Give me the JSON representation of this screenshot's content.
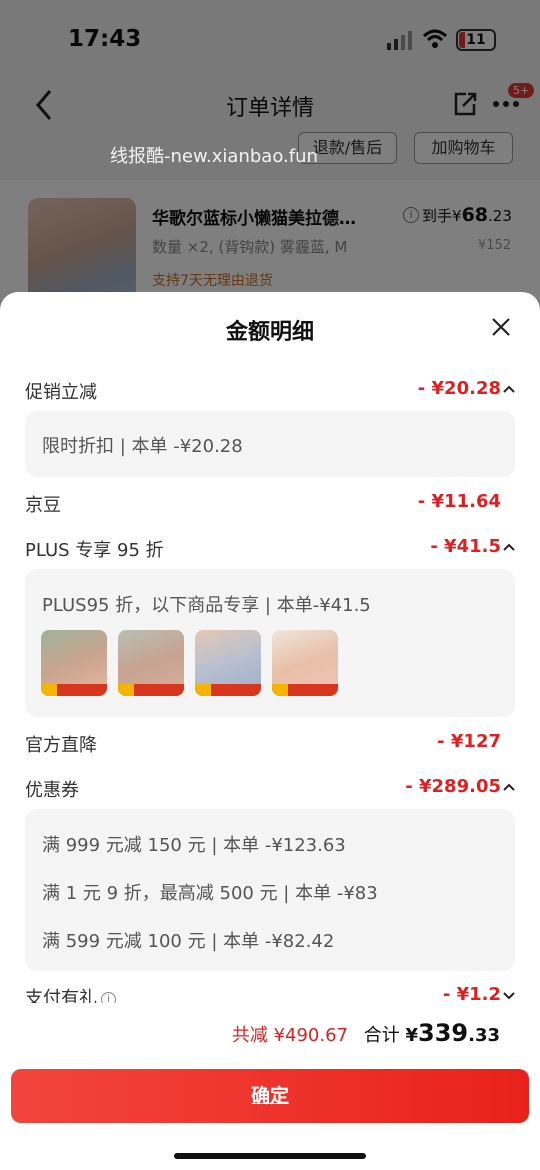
{
  "status_bar": {
    "time": "17:43",
    "battery": "11",
    "icons": [
      "signal-icon",
      "wifi-icon",
      "battery-icon"
    ]
  },
  "background_page": {
    "title": "订单详情",
    "more_badge": "5+",
    "watermark": "线报酷-new.xianbao.fun",
    "refund_button": "退款/售后",
    "add_cart_button": "加购物车",
    "product": {
      "title": "华歌尔蓝标小懒猫美拉德…",
      "spec": "数量 ×2, (背钩款) 雾霾蓝, M",
      "return_policy": "支持7天无理由退货",
      "price_prefix": "到手",
      "price_symbol": "¥",
      "price_int": "68",
      "price_dec": ".23",
      "original_price": "¥152"
    }
  },
  "sheet": {
    "title": "金额明细",
    "lines": {
      "promo": {
        "label": "促销立减",
        "amount": "- ¥20.28",
        "expanded": true
      },
      "jingdou": {
        "label": "京豆",
        "amount": "- ¥11.64"
      },
      "plus": {
        "label": "PLUS 专享 95 折",
        "amount": "- ¥41.5",
        "expanded": true
      },
      "official": {
        "label": "官方直降",
        "amount": "- ¥127"
      },
      "coupon": {
        "label": "优惠券",
        "amount": "- ¥289.05",
        "expanded": true
      },
      "pay_gift": {
        "label": "支付有礼",
        "amount": "- ¥1.2",
        "expanded": false
      }
    },
    "details": {
      "promo": "限时折扣 | 本单 -¥20.28",
      "plus": "PLUS95 折，以下商品专享 | 本单-¥41.5",
      "coupons": [
        "满 999 元减 150 元 | 本单 -¥123.63",
        "满 1 元 9 折，最高减 500 元 | 本单 -¥83",
        "满 599 元减 100 元 | 本单 -¥82.42"
      ]
    },
    "footer": {
      "total_reduce": "共减 ¥490.67",
      "sum_label": "合计",
      "sum_symbol": "¥",
      "sum_int": "339",
      "sum_dec": ".33",
      "confirm": "确定"
    }
  },
  "colors": {
    "accent_red": "#e02020",
    "button_red": "#f2453d",
    "detail_bg": "#f5f5f5"
  }
}
